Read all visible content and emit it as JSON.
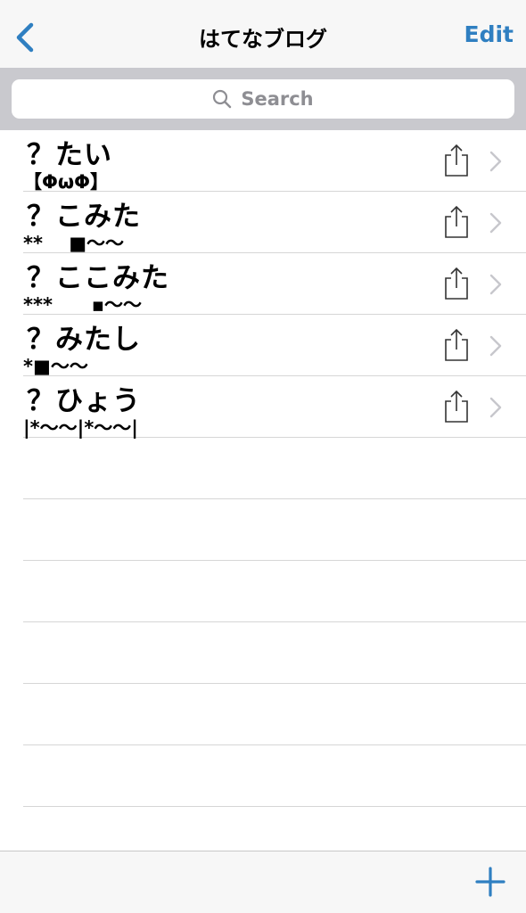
{
  "navbar": {
    "title": "はてなブログ",
    "edit_label": "Edit",
    "accent_color": "#2f7fc1",
    "back_icon": "chevron-left-icon"
  },
  "search": {
    "placeholder": "Search",
    "icon": "search-icon"
  },
  "entries": [
    {
      "title": "？たい",
      "subtitle": "【ΦωΦ】"
    },
    {
      "title": "？こみた",
      "subtitle": "**    ■〜〜"
    },
    {
      "title": "？ここみた",
      "subtitle": "***      ▪︎〜〜"
    },
    {
      "title": "？みたし",
      "subtitle": "*■〜〜"
    },
    {
      "title": "？ひょう",
      "subtitle": "|*〜〜|*〜〜|"
    }
  ],
  "row_icons": {
    "share": "share-icon",
    "disclosure": "chevron-right-icon"
  },
  "toolbar": {
    "add_icon": "plus-icon"
  }
}
